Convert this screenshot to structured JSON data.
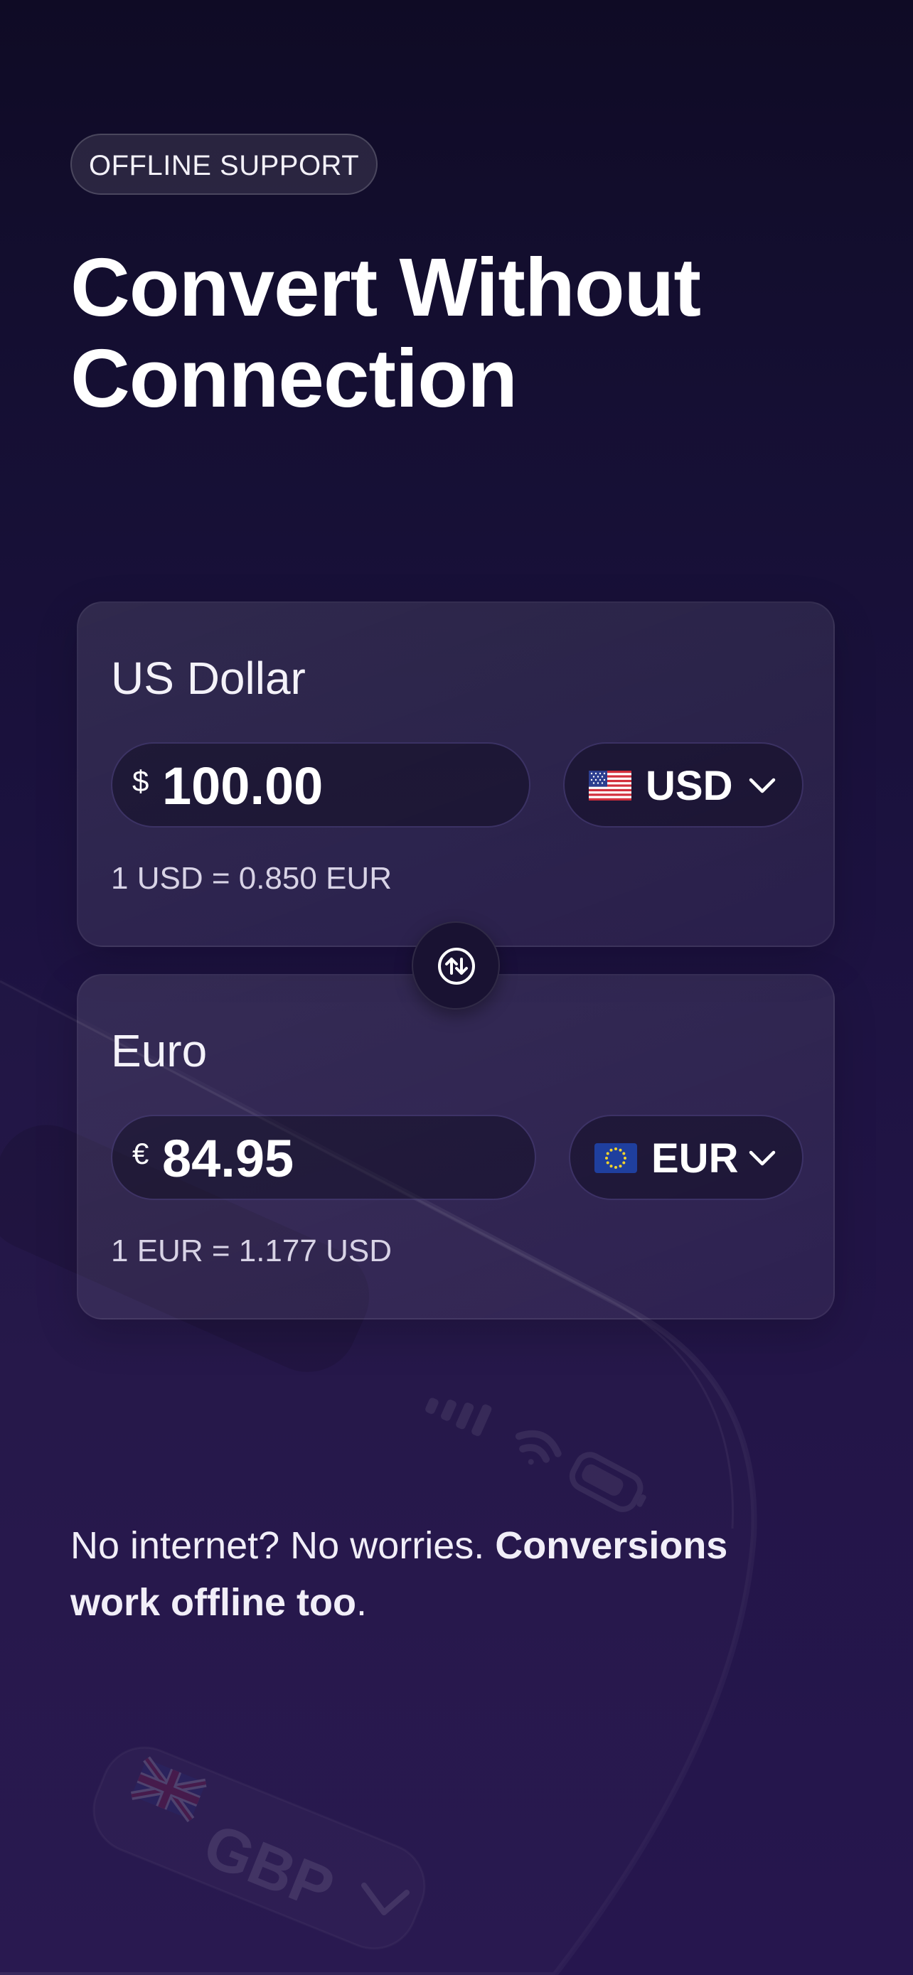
{
  "badge": {
    "label": "OFFLINE SUPPORT"
  },
  "headline": {
    "line1": "Convert Without",
    "line2": "Connection"
  },
  "converter": {
    "from": {
      "name": "US Dollar",
      "symbol": "$",
      "amount": "100.00",
      "code": "USD",
      "rate": "1 USD = 0.850 EUR"
    },
    "to": {
      "name": "Euro",
      "symbol": "€",
      "amount": "84.95",
      "code": "EUR",
      "rate": "1 EUR = 1.177 USD"
    }
  },
  "tagline": {
    "regular": "No internet? No worries. ",
    "bold": "Conversions work offline too",
    "end": "."
  },
  "background": {
    "ghost_currency": "GBP"
  },
  "icons": {
    "swap": "swap-vertical-icon",
    "chevron": "chevron-down-icon",
    "signal": "signal-icon",
    "wifi": "wifi-icon",
    "battery": "battery-icon"
  },
  "colors": {
    "background_top": "#0f0b25",
    "background_bottom": "#26164e",
    "accent_border": "#8c78dc"
  }
}
